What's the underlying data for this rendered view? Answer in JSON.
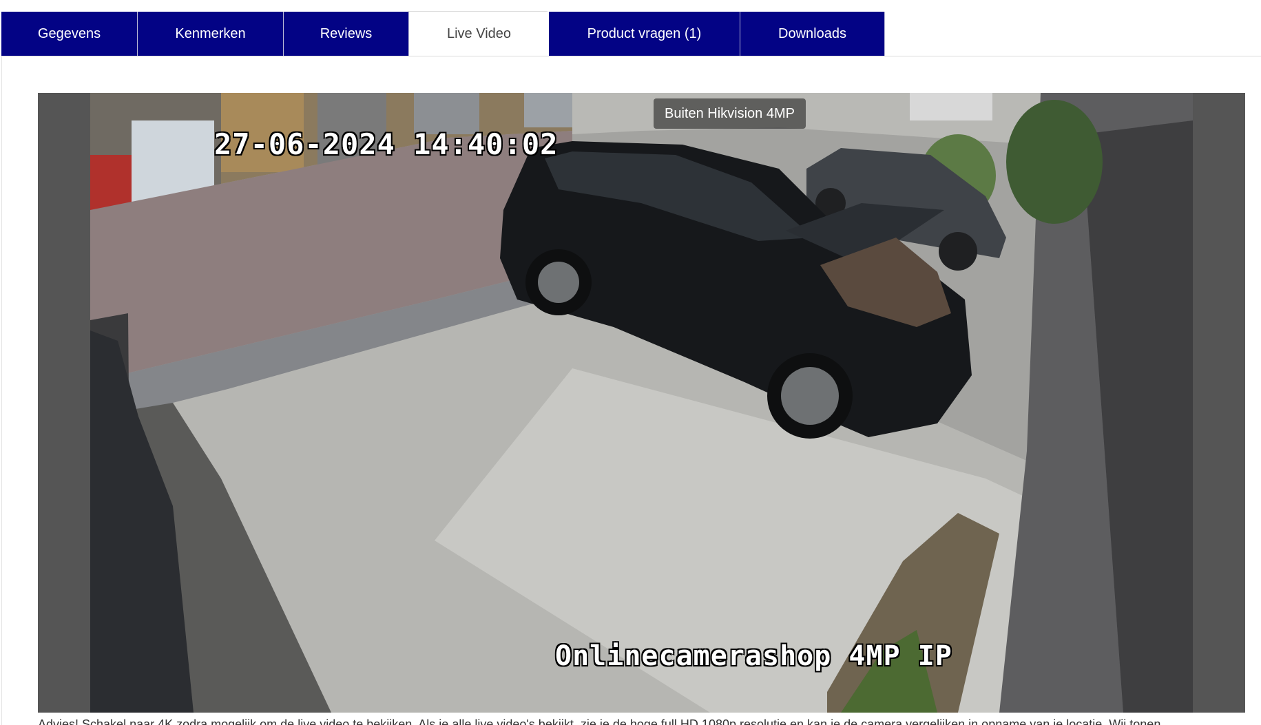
{
  "tabs": [
    {
      "label": "Gegevens",
      "active": false
    },
    {
      "label": "Kenmerken",
      "active": false
    },
    {
      "label": "Reviews",
      "active": false
    },
    {
      "label": "Live Video",
      "active": true
    },
    {
      "label": "Product vragen (1)",
      "active": false
    },
    {
      "label": "Downloads",
      "active": false
    }
  ],
  "video": {
    "title": "Buiten Hikvision 4MP",
    "osd_timestamp": "27-06-2024 14:40:02",
    "osd_brand": "Onlinecamerashop 4MP IP"
  },
  "caption": {
    "text": "Advies! Schakel naar 4K zodra mogelijk om de live video te bekijken. Als je alle live video's bekijkt, zie je de hoge full HD 1080p resolutie en kan je de camera vergelijken in opname van je locatie. Wij tonen"
  },
  "colors": {
    "tab_bg": "#030385",
    "tab_text": "#ffffff",
    "tab_active_text": "#444444",
    "player_frame": "#555555"
  }
}
